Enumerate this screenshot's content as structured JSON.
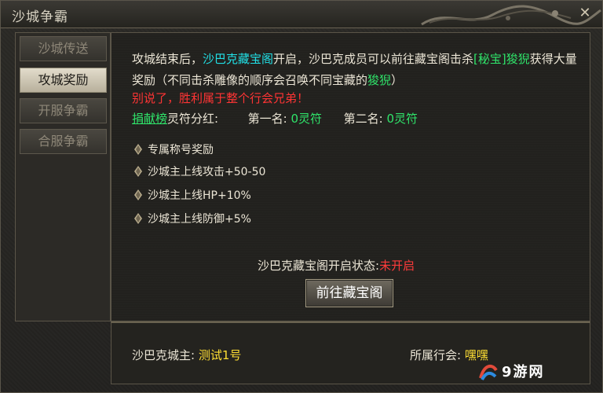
{
  "window": {
    "title": "沙城争霸"
  },
  "sidebar": {
    "tabs": [
      {
        "label": "沙城传送",
        "active": false
      },
      {
        "label": "攻城奖励",
        "active": true
      },
      {
        "label": "开服争霸",
        "active": false
      },
      {
        "label": "合服争霸",
        "active": false
      }
    ]
  },
  "content": {
    "intro": {
      "part1": "攻城结束后，",
      "treasure_name": "沙巴克藏宝阁",
      "part2": "开启，沙巴克成员可以前往藏宝阁击杀",
      "target_name": "[秘宝]狻猊",
      "part3": "获得大量奖励（不同击杀雕像的顺序会召唤不同宝藏的",
      "target_name2": "狻猊",
      "part4": "）"
    },
    "warning": "别说了，胜利属于整个行会兄弟！",
    "ranking": {
      "link_label": "捐献榜",
      "label": "灵符分红:",
      "first_label": "第一名:",
      "first_value": "0灵符",
      "second_label": "第二名:",
      "second_value": "0灵符"
    },
    "rewards": [
      "专属称号奖励",
      "沙城主上线攻击+50-50",
      "沙城主上线HP+10%",
      "沙城主上线防御+5%"
    ],
    "status": {
      "label": "沙巴克藏宝阁开启状态:",
      "value": "未开启"
    },
    "go_button": "前往藏宝阁"
  },
  "footer": {
    "lord_label": "沙巴克城主:",
    "lord_value": "测试1号",
    "guild_label": "所属行会:",
    "guild_value": "嘿嘿"
  },
  "watermark": "9游网"
}
